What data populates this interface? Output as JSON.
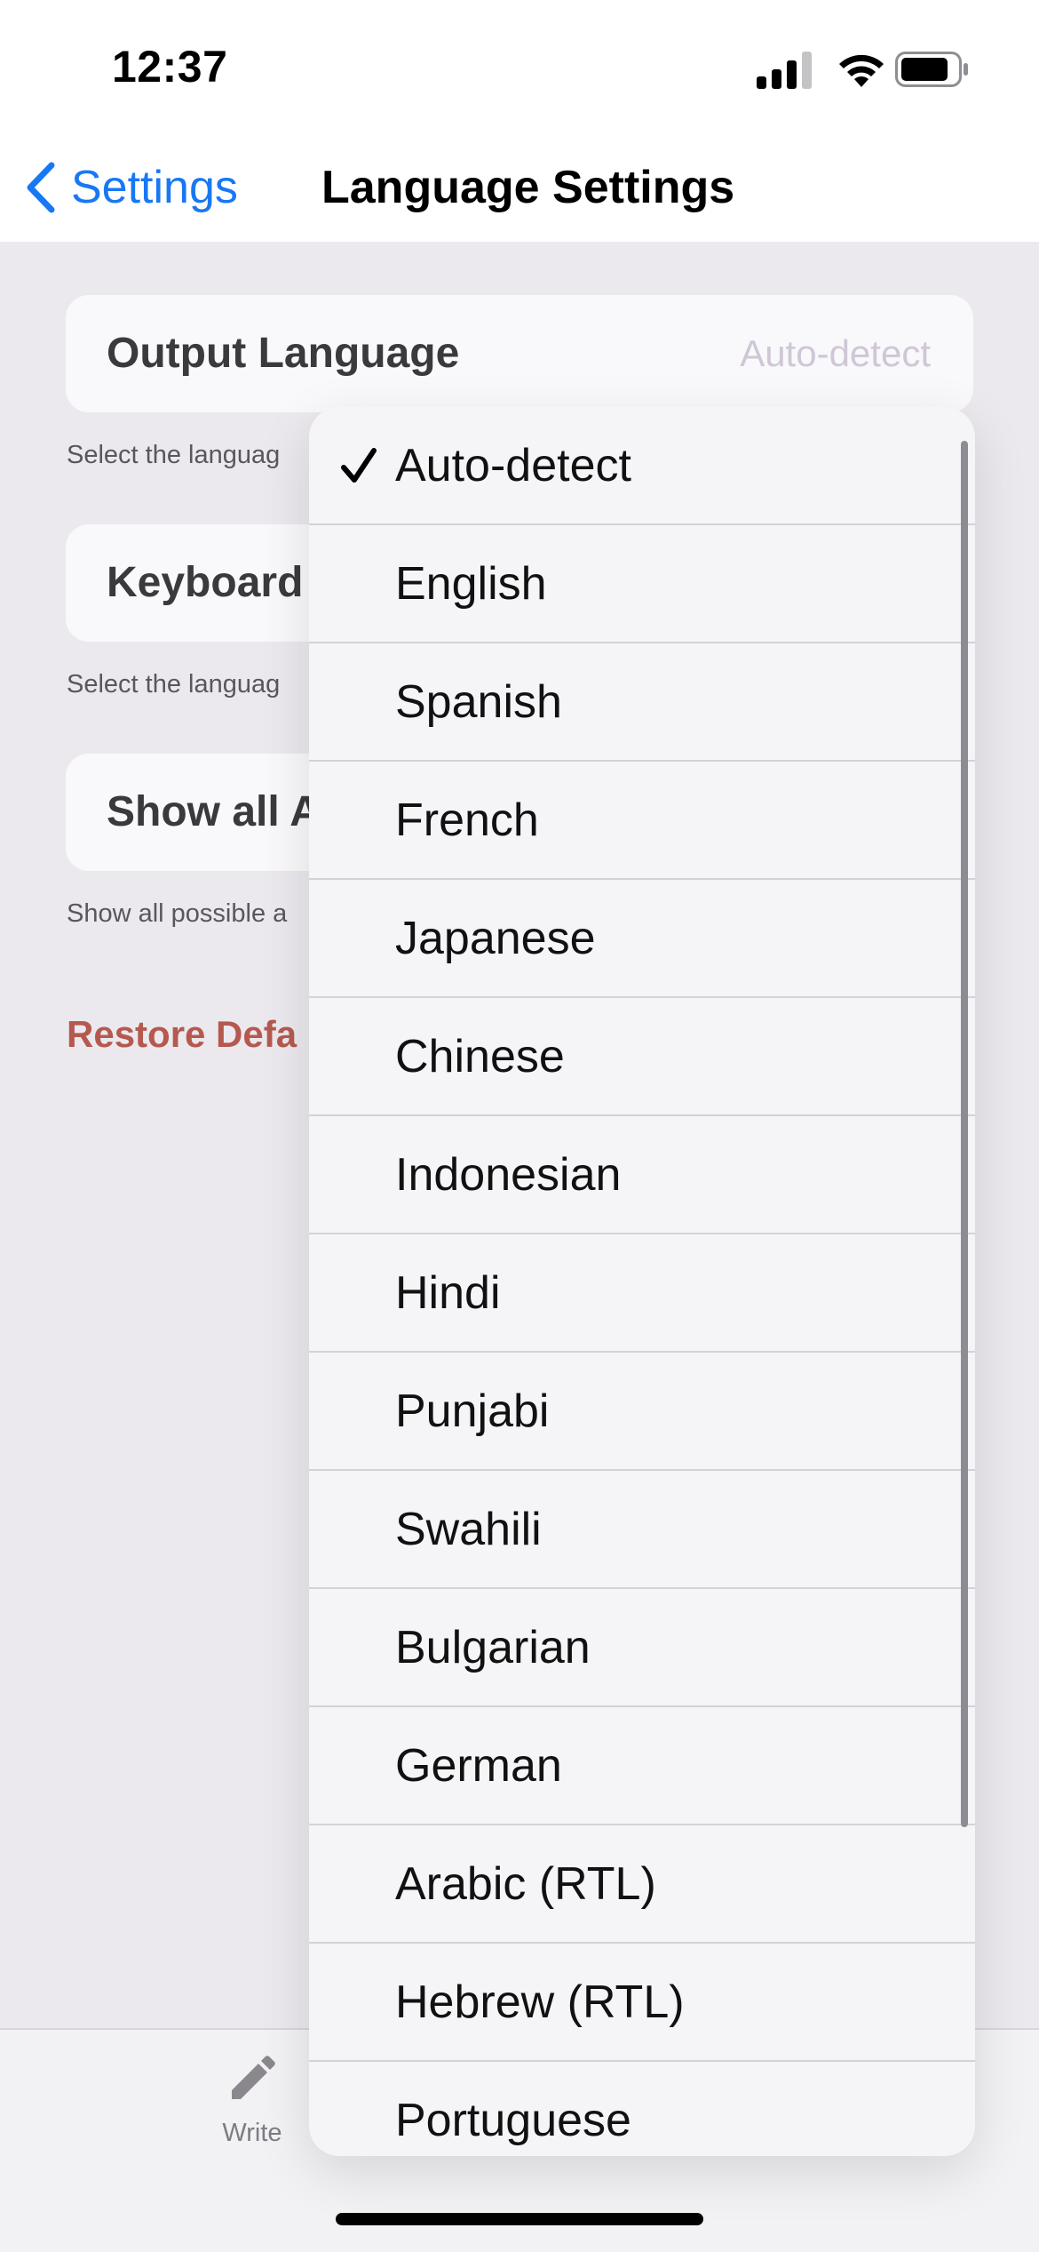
{
  "status_bar": {
    "time": "12:37"
  },
  "nav": {
    "back_label": "Settings",
    "title": "Language Settings"
  },
  "settings": {
    "output_language": {
      "title": "Output Language",
      "value": "Auto-detect",
      "hint": "Select the languag"
    },
    "keyboard": {
      "title": "Keyboard",
      "hint": "Select the languag"
    },
    "show_all": {
      "title": "Show all A",
      "hint": "Show all possible a"
    },
    "restore_label": "Restore Defa"
  },
  "tab_bar": {
    "write_label": "Write"
  },
  "dropdown": {
    "selected": "Auto-detect",
    "options": [
      "Auto-detect",
      "English",
      "Spanish",
      "French",
      "Japanese",
      "Chinese",
      "Indonesian",
      "Hindi",
      "Punjabi",
      "Swahili",
      "Bulgarian",
      "German",
      "Arabic (RTL)",
      "Hebrew (RTL)",
      "Portuguese"
    ]
  },
  "colors": {
    "accent_blue": "#1878f3",
    "destructive_red": "#b5594f",
    "placeholder_value": "#cfc7d6"
  },
  "icons": {
    "back": "chevron-left-icon",
    "write": "pencil-icon",
    "selected": "checkmark-icon",
    "signal": "cellular-signal-icon",
    "wifi": "wifi-icon",
    "battery": "battery-icon"
  }
}
